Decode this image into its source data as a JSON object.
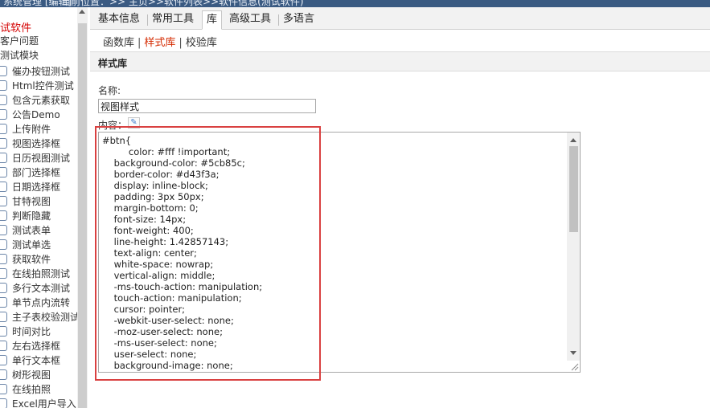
{
  "header": {
    "title_fragment": "系统管理 [编辑]",
    "breadcrumb_fragment": "当前位置：>> 主页>>软件列表>>软件信息(测试软件)"
  },
  "sidebar": {
    "root": "试软件",
    "level1": [
      "客户问题",
      "测试模块"
    ],
    "items": [
      "催办按钮测试",
      "Html控件测试",
      "包含元素获取",
      "公告Demo",
      "上传附件",
      "视图选择框",
      "日历视图测试",
      "部门选择框",
      "日期选择框",
      "甘特视图",
      "判断隐藏",
      "测试表单",
      "测试单选",
      "获取软件",
      "在线拍照测试",
      "多行文本测试",
      "单节点内流转",
      "主子表校验测试",
      "时间对比",
      "左右选择框",
      "单行文本框",
      "树形视图",
      "在线拍照",
      "Excel用户导入"
    ]
  },
  "tabs": [
    "基本信息",
    "常用工具",
    "库",
    "高级工具",
    "多语言"
  ],
  "subtabs": [
    "函数库",
    "样式库",
    "校验库"
  ],
  "section_title": "样式库",
  "form": {
    "name_label": "名称:",
    "name_value": "视图样式",
    "content_label": "内容：",
    "content_lines": [
      "#btn{",
      "         color: #fff !important;",
      "    background-color: #5cb85c;",
      "    border-color: #d43f3a;",
      "    display: inline-block;",
      "    padding: 3px 50px;",
      "    margin-bottom: 0;",
      "    font-size: 14px;",
      "    font-weight: 400;",
      "    line-height: 1.42857143;",
      "    text-align: center;",
      "    white-space: nowrap;",
      "    vertical-align: middle;",
      "    -ms-touch-action: manipulation;",
      "    touch-action: manipulation;",
      "    cursor: pointer;",
      "    -webkit-user-select: none;",
      "    -moz-user-select: none;",
      "    -ms-user-select: none;",
      "    user-select: none;",
      "    background-image: none;"
    ]
  },
  "colors": {
    "topbar": "#3a5a82",
    "active_red": "#d42a00",
    "highlight": "#d94141"
  },
  "icons": {
    "tree_item": "document-icon",
    "content_helper": "edit-icon"
  }
}
